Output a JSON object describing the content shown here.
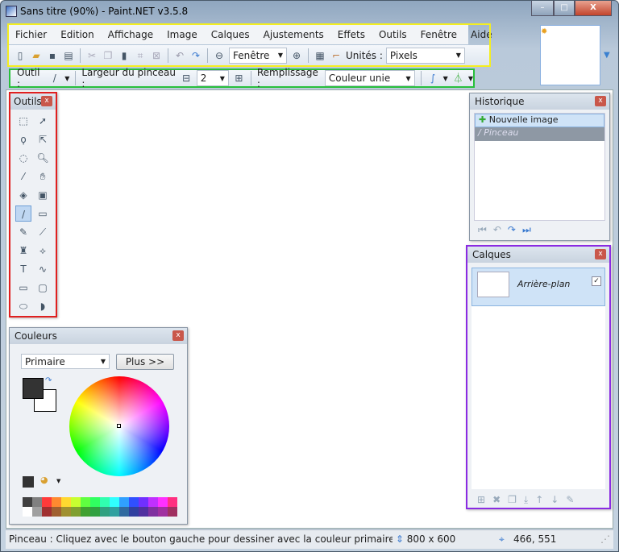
{
  "window": {
    "title": "Sans titre (90%) - Paint.NET v3.5.8",
    "minimize": "–",
    "maximize": "□",
    "close": "X"
  },
  "menu": [
    "Fichier",
    "Edition",
    "Affichage",
    "Image",
    "Calques",
    "Ajustements",
    "Effets",
    "Outils",
    "Fenêtre",
    "Aide"
  ],
  "toolbar": {
    "zoom_value": "Fenêtre",
    "units_label": "Unités :",
    "units_value": "Pixels"
  },
  "tool_options": {
    "tool_label": "Outil :",
    "brush_width_label": "Largeur du pinceau :",
    "brush_width_value": "2",
    "fill_label": "Remplissage :",
    "fill_value": "Couleur unie"
  },
  "tools_panel": {
    "title": "Outils",
    "tools": [
      "rectangle-select",
      "move-selection",
      "lasso-select",
      "move-selection-outline",
      "ellipse-select",
      "zoom",
      "magic-wand",
      "pan",
      "paint-bucket",
      "gradient",
      "paintbrush",
      "eraser",
      "pencil",
      "color-picker",
      "clone-stamp",
      "recolor",
      "text",
      "line-curve",
      "rectangle",
      "rounded-rectangle",
      "ellipse",
      "freeform-shape"
    ],
    "active_tool": "paintbrush"
  },
  "colors_panel": {
    "title": "Couleurs",
    "mode": "Primaire",
    "more_button": "Plus >>",
    "primary_color": "#333333",
    "secondary_color": "#ffffff",
    "palette": [
      "#404040",
      "#808080",
      "#ff3a3a",
      "#ff8a30",
      "#ffd830",
      "#c8ff30",
      "#60ff40",
      "#30ff60",
      "#30ffb0",
      "#30ffff",
      "#30a0ff",
      "#3050ff",
      "#7030ff",
      "#c030ff",
      "#ff30ff",
      "#ff3080",
      "#ffffff",
      "#a0a0a0",
      "#a03030",
      "#a06030",
      "#a09030",
      "#80a030",
      "#40a030",
      "#30a040",
      "#30a080",
      "#30a0a0",
      "#306aa0",
      "#3040a0",
      "#5030a0",
      "#8030a0",
      "#a030a0",
      "#a03060"
    ]
  },
  "history_panel": {
    "title": "Historique",
    "items": [
      {
        "label": "Nouvelle image"
      },
      {
        "label": "Pinceau"
      }
    ]
  },
  "layers_panel": {
    "title": "Calques",
    "layers": [
      {
        "name": "Arrière-plan",
        "visible": true
      }
    ]
  },
  "status": {
    "hint": "Pinceau : Cliquez avec le bouton gauche pour dessiner avec la couleur primaire ; cliquez av",
    "image_size": "800 x 600",
    "cursor_pos": "466, 551"
  },
  "highlights": {
    "yellow": "#f4ee20",
    "green": "#28c03c",
    "red": "#e02020",
    "purple": "#8a2be2"
  }
}
